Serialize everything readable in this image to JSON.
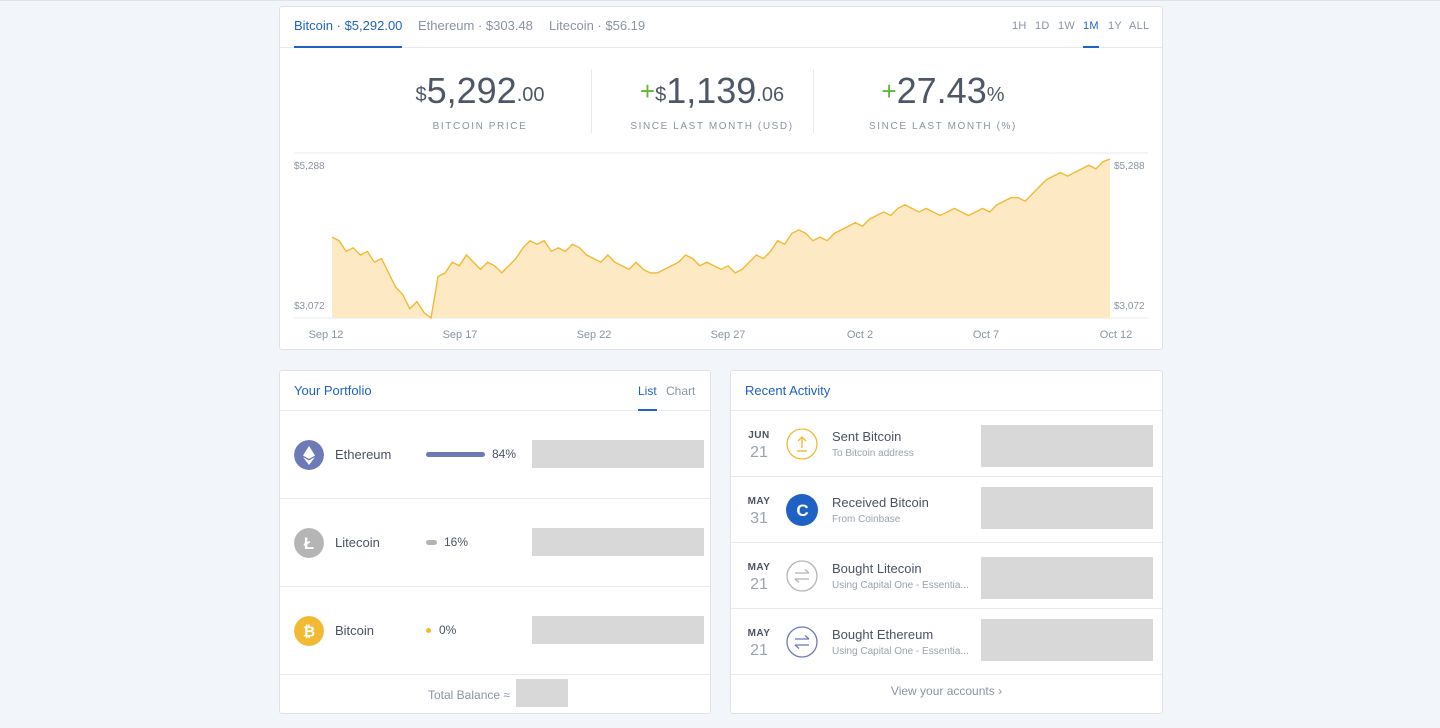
{
  "asset_tabs": [
    {
      "label": "Bitcoin · $5,292.00",
      "active": true
    },
    {
      "label": "Ethereum · $303.48",
      "active": false
    },
    {
      "label": "Litecoin · $56.19",
      "active": false
    }
  ],
  "range_tabs": [
    "1H",
    "1D",
    "1W",
    "1M",
    "1Y",
    "ALL"
  ],
  "active_range": "1M",
  "stats": {
    "price": {
      "currency": "$",
      "whole": "5,292",
      "cents": ".00",
      "label": "BITCOIN PRICE"
    },
    "change_usd": {
      "sign": "+",
      "currency": "$",
      "whole": "1,139",
      "cents": ".06",
      "label": "SINCE LAST MONTH (USD)"
    },
    "change_pct": {
      "sign": "+",
      "whole": "27.43",
      "unit": "%",
      "label": "SINCE LAST MONTH (%)"
    }
  },
  "chart_data": {
    "type": "area",
    "x_ticks": [
      "Sep 12",
      "Sep 17",
      "Sep 22",
      "Sep 27",
      "Oct 2",
      "Oct 7",
      "Oct 12"
    ],
    "y_labels": {
      "high": "$5,288",
      "low": "$3,072"
    },
    "ylim": [
      3072,
      5288
    ],
    "series": [
      {
        "values": [
          4200,
          4150,
          4000,
          4050,
          3950,
          4000,
          3850,
          3900,
          3700,
          3500,
          3400,
          3200,
          3300,
          3150,
          3072,
          3650,
          3700,
          3850,
          3800,
          3950,
          3850,
          3750,
          3850,
          3800,
          3700,
          3800,
          3900,
          4050,
          4150,
          4100,
          4150,
          4000,
          4050,
          4000,
          4100,
          4050,
          3950,
          3900,
          3850,
          3950,
          3850,
          3800,
          3750,
          3850,
          3750,
          3700,
          3700,
          3750,
          3800,
          3850,
          3950,
          3900,
          3800,
          3850,
          3800,
          3750,
          3800,
          3700,
          3750,
          3850,
          3950,
          3900,
          4000,
          4150,
          4100,
          4250,
          4300,
          4250,
          4150,
          4200,
          4150,
          4250,
          4300,
          4350,
          4400,
          4350,
          4450,
          4500,
          4550,
          4500,
          4600,
          4650,
          4600,
          4550,
          4600,
          4550,
          4500,
          4550,
          4600,
          4550,
          4500,
          4550,
          4600,
          4550,
          4650,
          4700,
          4750,
          4750,
          4700,
          4800,
          4900,
          5000,
          5050,
          5100,
          5050,
          5100,
          5150,
          5200,
          5150,
          5250,
          5288
        ]
      }
    ],
    "color": "#f2b932",
    "fill": "#fdeac5"
  },
  "portfolio": {
    "title": "Your Portfolio",
    "view_tabs": [
      "List",
      "Chart"
    ],
    "active_view": "List",
    "rows": [
      {
        "name": "Ethereum",
        "percent": "84%",
        "share": 0.84,
        "color": "#6e7ab8",
        "icon": "ethereum-icon"
      },
      {
        "name": "Litecoin",
        "percent": "16%",
        "share": 0.16,
        "color": "#b5b5b5",
        "icon": "litecoin-icon"
      },
      {
        "name": "Bitcoin",
        "percent": "0%",
        "share": 0.0,
        "color": "#f2b932",
        "icon": "bitcoin-icon"
      }
    ],
    "total_label": "Total Balance ≈"
  },
  "activity": {
    "title": "Recent Activity",
    "rows": [
      {
        "month": "JUN",
        "day": "21",
        "title": "Sent Bitcoin",
        "subtitle": "To Bitcoin address",
        "icon": "send-icon"
      },
      {
        "month": "MAY",
        "day": "31",
        "title": "Received Bitcoin",
        "subtitle": "From Coinbase",
        "icon": "coinbase-icon"
      },
      {
        "month": "MAY",
        "day": "21",
        "title": "Bought Litecoin",
        "subtitle": "Using Capital One - Essentia...",
        "icon": "exchange-icon"
      },
      {
        "month": "MAY",
        "day": "21",
        "title": "Bought Ethereum",
        "subtitle": "Using Capital One - Essentia...",
        "icon": "exchange-icon"
      }
    ],
    "view_link": "View your accounts ›"
  }
}
